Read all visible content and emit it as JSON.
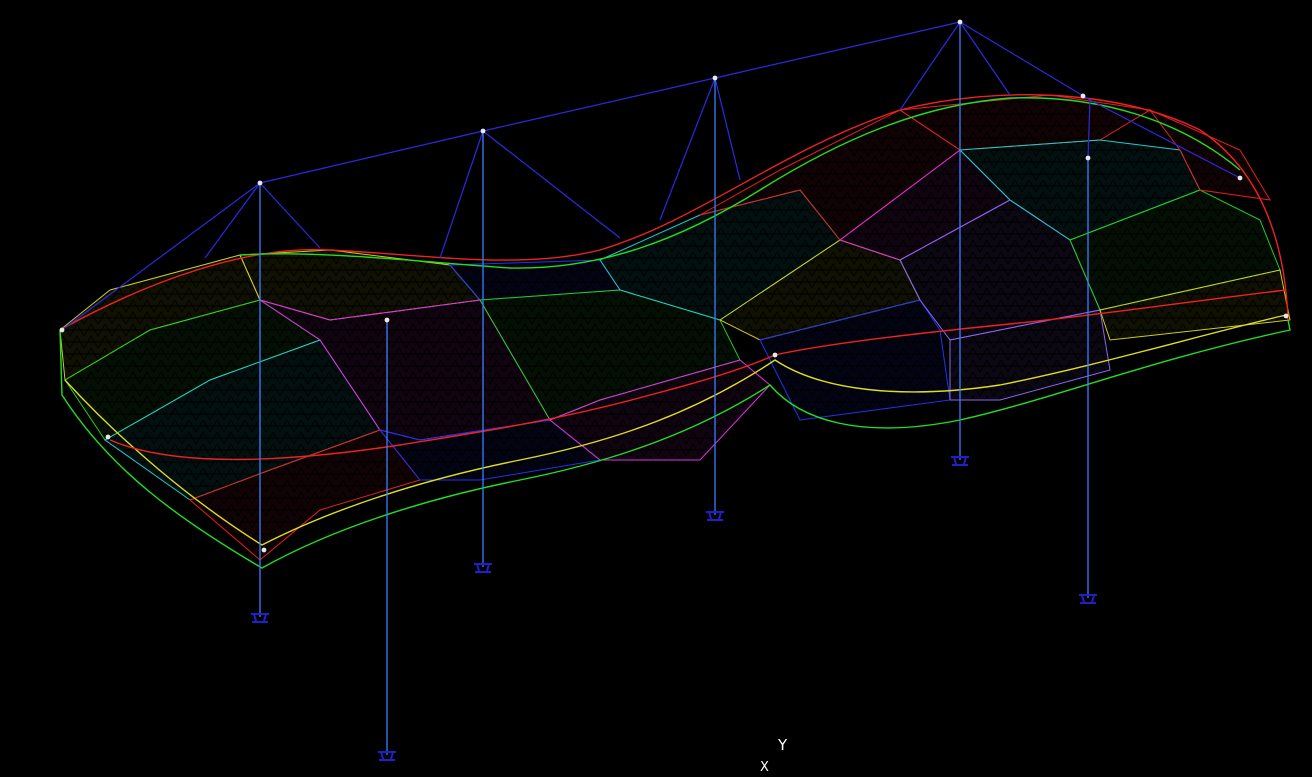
{
  "view": {
    "background": "#000000",
    "axis_indicator": {
      "y_label": "Y",
      "x_label": "X"
    }
  },
  "colors": {
    "cable": "#2a2ae0",
    "column": "#3a7fff",
    "support": "#2020c8",
    "node": "#e8e8e8",
    "edge_green": "#22dd22",
    "edge_red": "#ee2222",
    "edge_yellow": "#dddd22",
    "panel_green": "#22cc22",
    "panel_cyan": "#22cccc",
    "panel_magenta": "#dd33dd",
    "panel_blue": "#2233ee",
    "panel_red": "#dd2222",
    "panel_yellow": "#cccc22",
    "panel_purple": "#8866ee"
  },
  "icons": [
    "pinned-support-icon",
    "cable-node-icon"
  ]
}
